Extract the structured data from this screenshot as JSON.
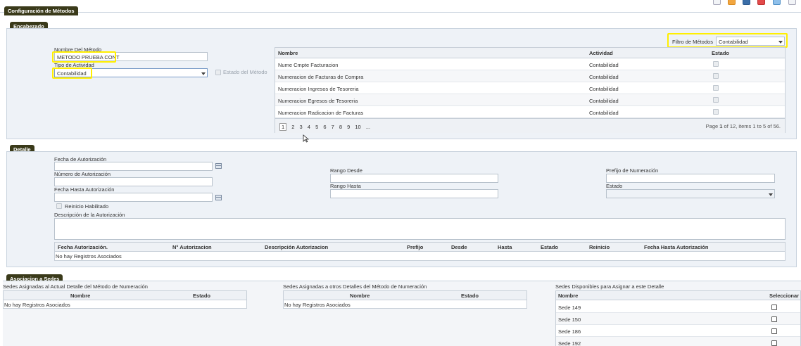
{
  "window_title": "Configuración de Métodos",
  "toolbar_icons": [
    "page-icon",
    "orange-icon",
    "save-icon",
    "pdf-icon",
    "globe-icon",
    "help-icon"
  ],
  "encabezado": {
    "section_label": "Encabezado",
    "nombre_label": "Nombre Del Método",
    "nombre_value": "METODO PRUEBA CONT",
    "tipo_label": "Tipo de Actividad",
    "tipo_value": "Contabilidad",
    "estado_metodo_label": "Estado del Método",
    "filtro_label": "Filtro de Métodos",
    "filtro_value": "Contabilidad",
    "table_headers": [
      "Nombre",
      "Actividad",
      "Estado"
    ],
    "rows": [
      {
        "nombre": "Nume Cmpte Facturacion",
        "actividad": "Contabilidad"
      },
      {
        "nombre": "Numeracion de Facturas de Compra",
        "actividad": "Contabilidad"
      },
      {
        "nombre": "Numeracion Ingresos de Tesoreria",
        "actividad": "Contabilidad"
      },
      {
        "nombre": "Numeracion Egresos de Tesoreria",
        "actividad": "Contabilidad"
      },
      {
        "nombre": "Numeracion Radicacion de Facturas",
        "actividad": "Contabilidad"
      }
    ],
    "pages": [
      "1",
      "2",
      "3",
      "4",
      "5",
      "6",
      "7",
      "8",
      "9",
      "10",
      "..."
    ],
    "page_info_prefix": "Page",
    "page_current": "1",
    "page_info_suffix": "of 12, items 1 to 5 of 56."
  },
  "detalle": {
    "section_label": "Detalle",
    "fecha_autorizacion_label": "Fecha de Autorización",
    "numero_autorizacion_label": "Número de Autorización",
    "fecha_hasta_label": "Fecha Hasta Autorización",
    "reinicio_label": "Reinicio Habilitado",
    "rango_desde_label": "Rango Desde",
    "rango_hasta_label": "Rango Hasta",
    "prefijo_label": "Prefijo de Numeración",
    "estado_label": "Estado",
    "descripcion_label": "Descripción de la Autorización",
    "table_headers": [
      "Fecha Autorización.",
      "N° Autorizacion",
      "Descripción Autorizacion",
      "Prefijo",
      "Desde",
      "Hasta",
      "Estado",
      "Reinicio",
      "Fecha Hasta Autorización"
    ],
    "empty_text": "No hay Registros Asociados"
  },
  "sedes": {
    "section_label": "Asociacion a Sedes",
    "asignadas_title": "Sedes Asignadas al Actual Detalle del Método de Numeración",
    "otros_title": "Sedes Asignadas a otros Detalles del Método de Numeración",
    "disponibles_title": "Sedes Disponibles para Asignar a este Detalle",
    "col_nombre": "Nombre",
    "col_estado": "Estado",
    "col_seleccionar": "Seleccionar",
    "empty_text": "No hay Registros Asociados",
    "disponibles": [
      "Sede 149",
      "Sede 150",
      "Sede 186",
      "Sede 192"
    ]
  }
}
